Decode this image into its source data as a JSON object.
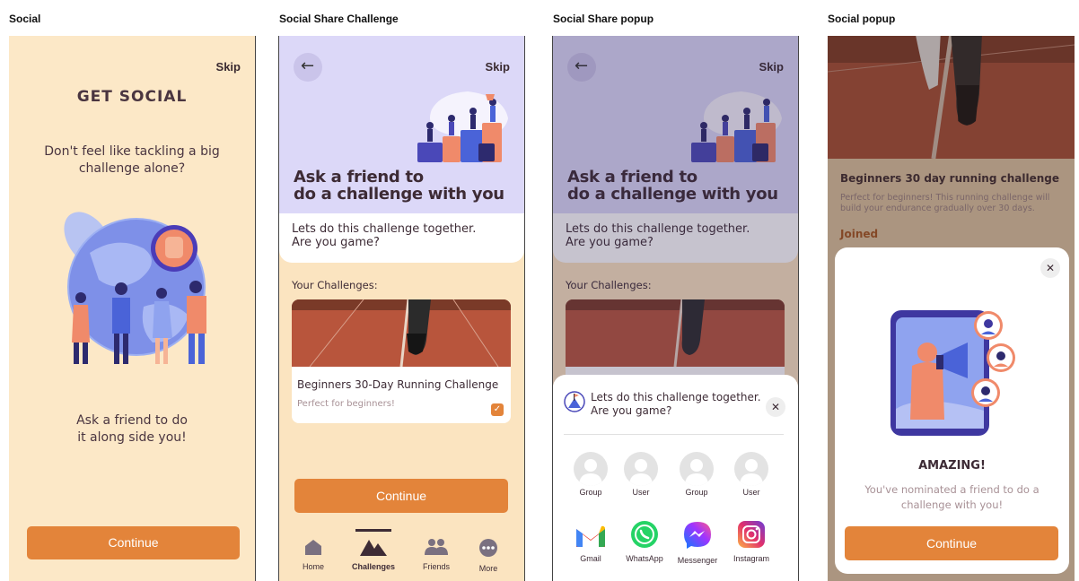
{
  "frames": {
    "social": "Social",
    "share_challenge": "Social Share Challenge",
    "share_popup": "Social Share popup",
    "social_popup": "Social popup"
  },
  "screen1": {
    "skip": "Skip",
    "title": "GET SOCIAL",
    "question_line1": "Don't feel like tackling a big",
    "question_line2": "challenge alone?",
    "prompt_line1": "Ask a friend to do",
    "prompt_line2": "it along side you!",
    "continue": "Continue"
  },
  "screen2": {
    "skip": "Skip",
    "hero_line1": "Ask a friend to",
    "hero_line2": "do a challenge with you",
    "card_line1": "Lets do this challenge together.",
    "card_line2": "Are you game?",
    "your_challenges": "Your Challenges:",
    "challenge_title": "Beginners 30-Day Running Challenge",
    "challenge_sub": "Perfect for beginners!",
    "continue": "Continue",
    "nav": [
      "Home",
      "Challenges",
      "Friends",
      "More"
    ]
  },
  "screen3": {
    "skip": "Skip",
    "hero_line1": "Ask a friend to",
    "hero_line2": "do a challenge with you",
    "card_line1": "Lets do this challenge together.",
    "card_line2": "Are you game?",
    "your_challenges": "Your Challenges:",
    "sheet_line1": "Lets do this challenge together.",
    "sheet_line2": "Are you game?",
    "contacts": [
      "Group",
      "User",
      "Group",
      "User"
    ],
    "apps": [
      "Gmail",
      "WhatsApp",
      "Messenger",
      "Instagram"
    ]
  },
  "screen4": {
    "challenge_title": "Beginners 30 day running challenge",
    "desc_line1": "Perfect for beginners! This running challenge will",
    "desc_line2": "build your endurance gradually over 30 days.",
    "joined": "Joined",
    "modal_title": "AMAZING!",
    "modal_line1": "You've nominated a friend to do a",
    "modal_line2": "challenge with you!",
    "continue": "Continue"
  },
  "colors": {
    "accent": "#e3843a",
    "cream": "#fce8c7",
    "lavender": "#dcd8f8",
    "dark_text": "#3d2b35"
  }
}
